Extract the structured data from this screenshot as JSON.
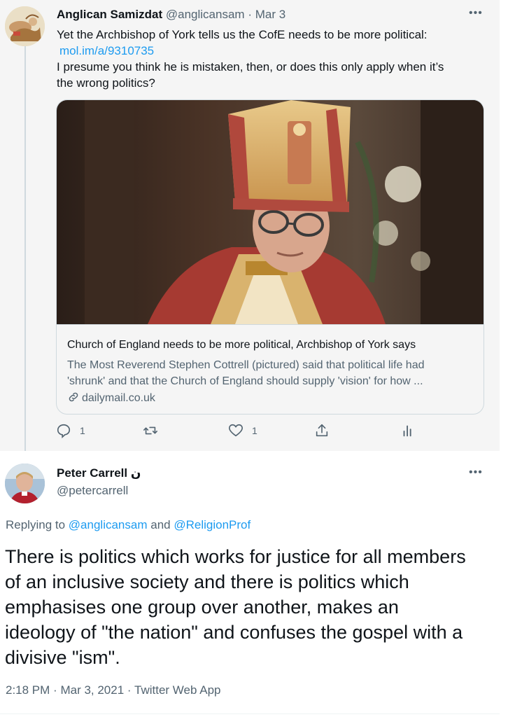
{
  "quoted_tweet": {
    "author_name": "Anglican Samizdat",
    "author_handle": "@anglicansam",
    "separator": "·",
    "date": "Mar 3",
    "more_icon": "more-horizontal-icon",
    "text_lines": [
      "Yet the Archbishop of York tells us the CofE needs to be more political:",
      "mol.im/a/9310735",
      "I presume you think he is mistaken, then, or does this only apply when it’s",
      "the wrong politics?"
    ],
    "card": {
      "title": "Church of England needs to be more political, Archbishop of York says",
      "description_lines": [
        "The Most Reverend Stephen Cottrell (pictured) said that political life had",
        "'shrunk' and that the Church of England should supply 'vision' for how ..."
      ],
      "domain": "dailymail.co.uk",
      "link_icon": "link-icon"
    },
    "actions": {
      "reply_count": "1",
      "retweet_count": "",
      "like_count": "1"
    }
  },
  "main_tweet": {
    "author_name": "Peter Carrell",
    "author_badge": "ن",
    "author_handle": "@petercarrell",
    "more_icon": "more-horizontal-icon",
    "replying_prefix": "Replying to",
    "reply_to_1": "@anglicansam",
    "reply_conjunction": "and",
    "reply_to_2": "@ReligionProf",
    "text_lines": [
      "There is politics which works for justice for all members",
      "of an inclusive society and there is politics which",
      "emphasises one group over another, makes an",
      "ideology of \"the nation\" and confuses the gospel with a",
      "divisive \"ism\"."
    ],
    "time": "2:18 PM",
    "date": "Mar 3, 2021",
    "source": "Twitter Web App",
    "meta_separator": "·"
  },
  "colors": {
    "link": "#1d9bf0",
    "muted": "#536471",
    "text": "#0f1419",
    "quoted_bg": "#f5f5f5"
  }
}
